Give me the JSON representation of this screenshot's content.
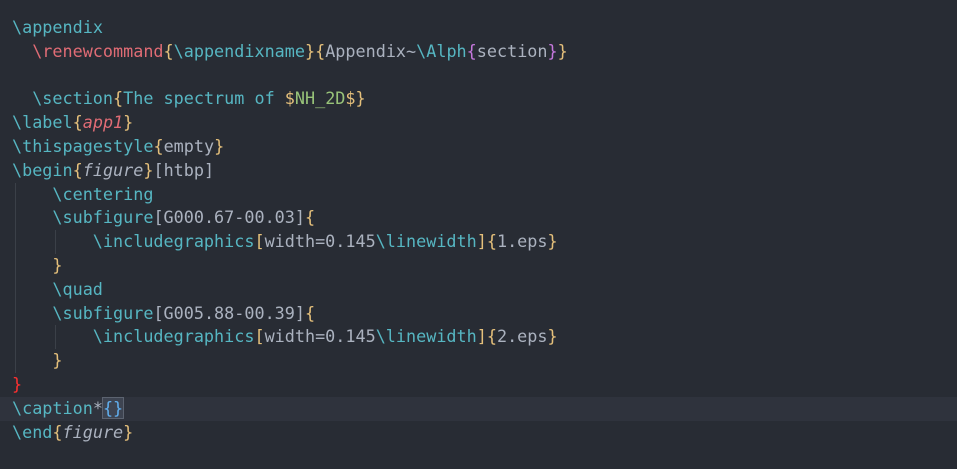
{
  "editor": {
    "lines": [
      {
        "indent": 0,
        "current": false,
        "guides": [],
        "tokens": [
          {
            "t": "\\appendix",
            "c": "cmd"
          }
        ]
      },
      {
        "indent": 2,
        "current": false,
        "guides": [],
        "tokens": [
          {
            "t": "\\renewcommand",
            "c": "cmd2"
          },
          {
            "t": "{",
            "c": "b1"
          },
          {
            "t": "\\appendixname",
            "c": "cmd"
          },
          {
            "t": "}",
            "c": "b1"
          },
          {
            "t": "{",
            "c": "b1"
          },
          {
            "t": "Appendix~",
            "c": "text"
          },
          {
            "t": "\\Alph",
            "c": "cmd"
          },
          {
            "t": "{",
            "c": "b2"
          },
          {
            "t": "section",
            "c": "text"
          },
          {
            "t": "}",
            "c": "b2"
          },
          {
            "t": "}",
            "c": "b1"
          }
        ]
      },
      {
        "indent": 0,
        "current": false,
        "guides": [],
        "tokens": []
      },
      {
        "indent": 2,
        "current": false,
        "guides": [],
        "tokens": [
          {
            "t": "\\section",
            "c": "cmd"
          },
          {
            "t": "{",
            "c": "b1"
          },
          {
            "t": "The spectrum of ",
            "c": "cmd"
          },
          {
            "t": "$",
            "c": "dollar"
          },
          {
            "t": "NH_2D",
            "c": "math"
          },
          {
            "t": "$",
            "c": "dollar"
          },
          {
            "t": "}",
            "c": "b1"
          }
        ]
      },
      {
        "indent": 0,
        "current": false,
        "guides": [],
        "tokens": [
          {
            "t": "\\label",
            "c": "cmd"
          },
          {
            "t": "{",
            "c": "b1"
          },
          {
            "t": "app1",
            "c": "label"
          },
          {
            "t": "}",
            "c": "b1"
          }
        ]
      },
      {
        "indent": 0,
        "current": false,
        "guides": [],
        "tokens": [
          {
            "t": "\\thispagestyle",
            "c": "cmd"
          },
          {
            "t": "{",
            "c": "b1"
          },
          {
            "t": "empty",
            "c": "text"
          },
          {
            "t": "}",
            "c": "b1"
          }
        ]
      },
      {
        "indent": 0,
        "current": false,
        "guides": [],
        "tokens": [
          {
            "t": "\\begin",
            "c": "cmd"
          },
          {
            "t": "{",
            "c": "b1"
          },
          {
            "t": "figure",
            "c": "italic"
          },
          {
            "t": "}",
            "c": "b1"
          },
          {
            "t": "[htbp]",
            "c": "text"
          }
        ]
      },
      {
        "indent": 4,
        "current": false,
        "guides": [
          0
        ],
        "tokens": [
          {
            "t": "\\centering",
            "c": "cmd"
          }
        ]
      },
      {
        "indent": 4,
        "current": false,
        "guides": [
          0
        ],
        "tokens": [
          {
            "t": "\\subfigure",
            "c": "cmd"
          },
          {
            "t": "[G000.67-00.03]",
            "c": "text"
          },
          {
            "t": "{",
            "c": "b1"
          }
        ]
      },
      {
        "indent": 8,
        "current": false,
        "guides": [
          0,
          4
        ],
        "tokens": [
          {
            "t": "\\includegraphics",
            "c": "cmd"
          },
          {
            "t": "[",
            "c": "b1"
          },
          {
            "t": "width=0.145",
            "c": "text"
          },
          {
            "t": "\\linewidth",
            "c": "cmd"
          },
          {
            "t": "]",
            "c": "b1"
          },
          {
            "t": "{",
            "c": "b1"
          },
          {
            "t": "1.eps",
            "c": "text"
          },
          {
            "t": "}",
            "c": "b1"
          }
        ]
      },
      {
        "indent": 4,
        "current": false,
        "guides": [
          0
        ],
        "tokens": [
          {
            "t": "}",
            "c": "b1"
          }
        ]
      },
      {
        "indent": 4,
        "current": false,
        "guides": [
          0
        ],
        "tokens": [
          {
            "t": "\\quad",
            "c": "cmd"
          }
        ]
      },
      {
        "indent": 4,
        "current": false,
        "guides": [
          0
        ],
        "tokens": [
          {
            "t": "\\subfigure",
            "c": "cmd"
          },
          {
            "t": "[G005.88-00.39]",
            "c": "text"
          },
          {
            "t": "{",
            "c": "b1"
          }
        ]
      },
      {
        "indent": 8,
        "current": false,
        "guides": [
          0,
          4
        ],
        "tokens": [
          {
            "t": "\\includegraphics",
            "c": "cmd"
          },
          {
            "t": "[",
            "c": "b1"
          },
          {
            "t": "width=0.145",
            "c": "text"
          },
          {
            "t": "\\linewidth",
            "c": "cmd"
          },
          {
            "t": "]",
            "c": "b1"
          },
          {
            "t": "{",
            "c": "b1"
          },
          {
            "t": "2.eps",
            "c": "text"
          },
          {
            "t": "}",
            "c": "b1"
          }
        ]
      },
      {
        "indent": 4,
        "current": false,
        "guides": [
          0
        ],
        "tokens": [
          {
            "t": "}",
            "c": "b1"
          }
        ]
      },
      {
        "indent": 0,
        "current": false,
        "guides": [],
        "tokens": [
          {
            "t": "}",
            "c": "err"
          }
        ]
      },
      {
        "indent": 0,
        "current": true,
        "guides": [],
        "tokens": [
          {
            "t": "\\caption",
            "c": "cmd"
          },
          {
            "t": "*",
            "c": "text"
          },
          {
            "t": "{}",
            "c": "sel"
          }
        ]
      },
      {
        "indent": 0,
        "current": false,
        "guides": [],
        "tokens": [
          {
            "t": "\\end",
            "c": "cmd"
          },
          {
            "t": "{",
            "c": "b1"
          },
          {
            "t": "figure",
            "c": "italic"
          },
          {
            "t": "}",
            "c": "b1"
          }
        ]
      }
    ]
  }
}
